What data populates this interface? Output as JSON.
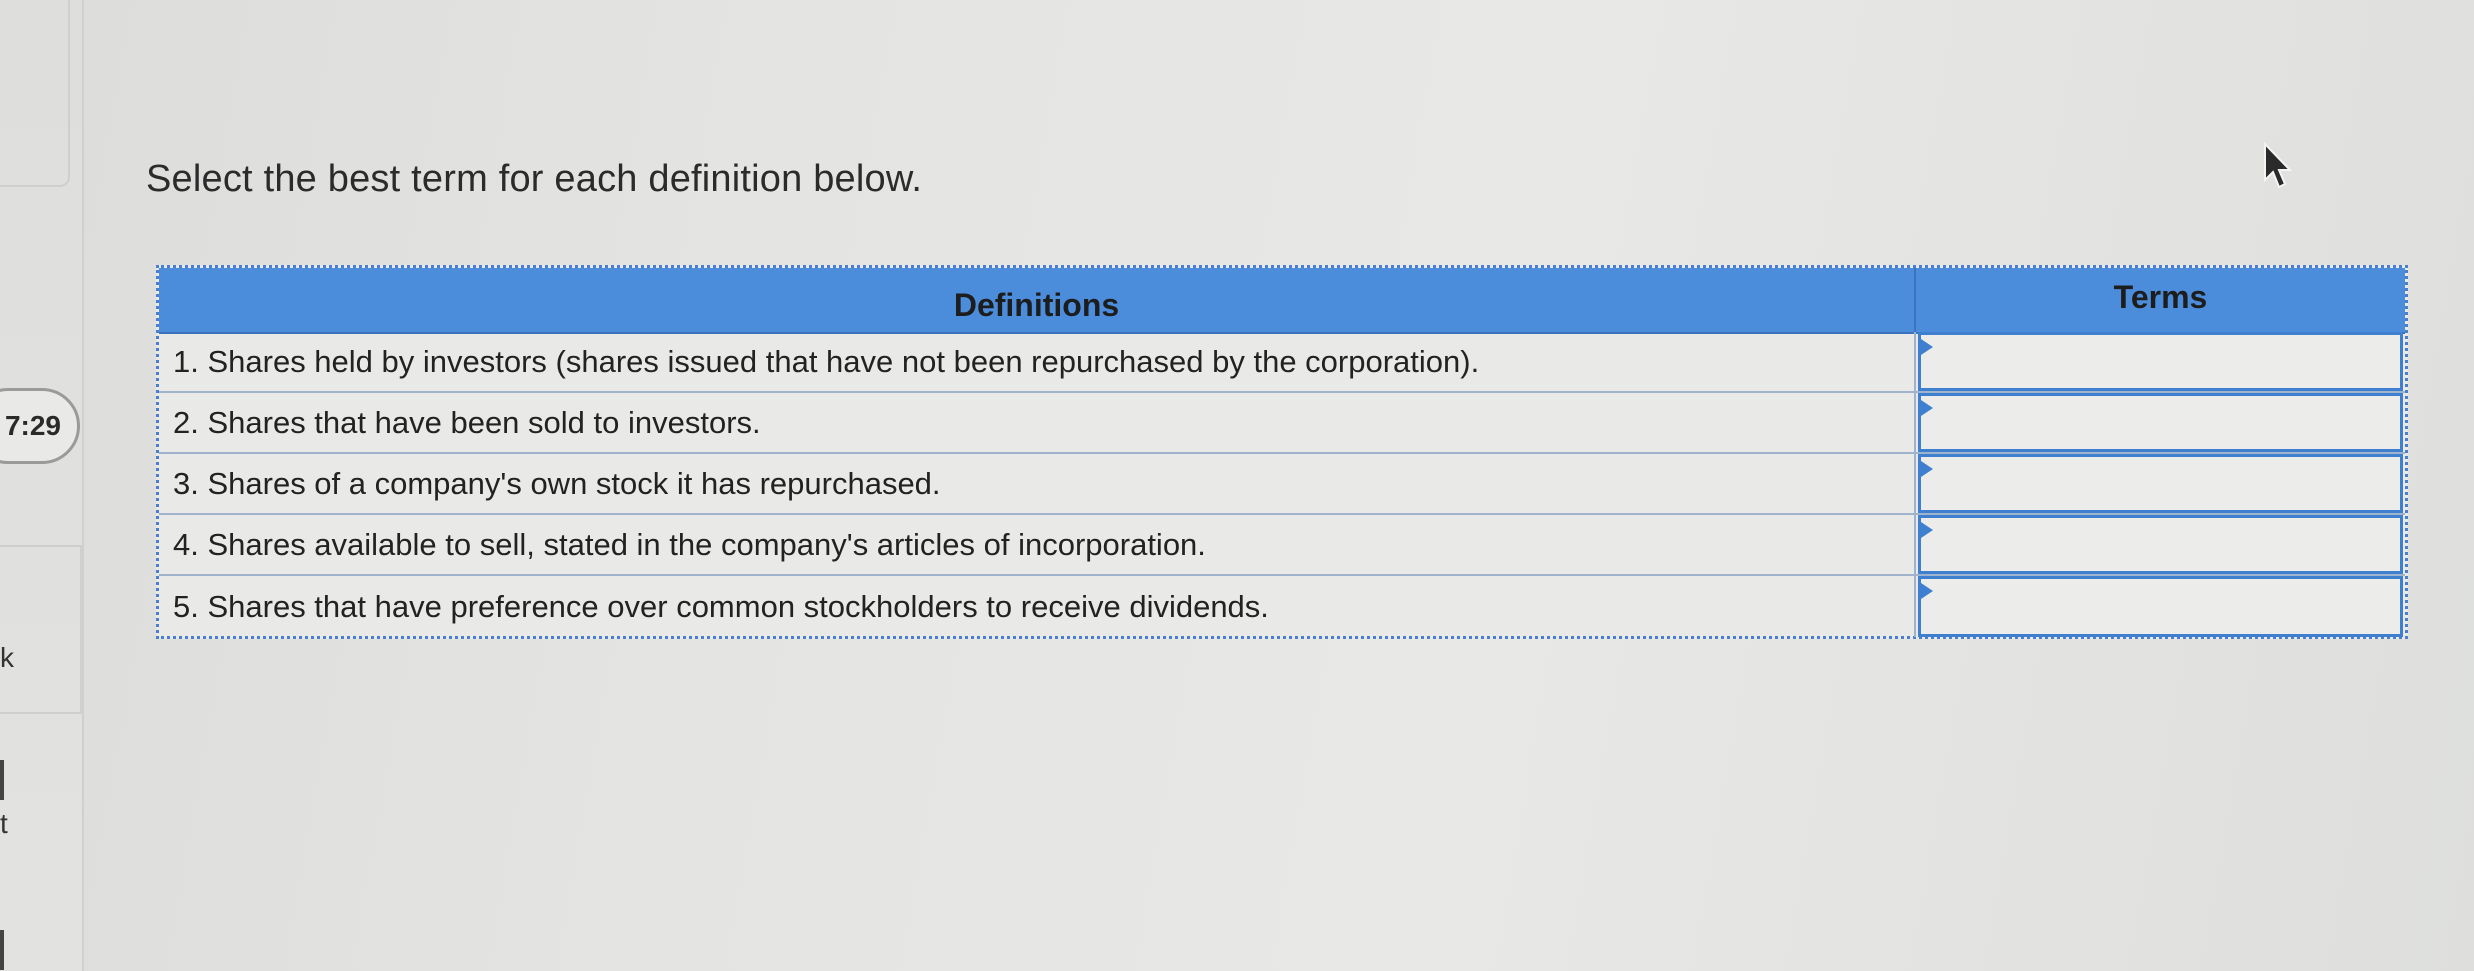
{
  "timer": "7:29",
  "sidebar": {
    "char_k": "k",
    "char_t": "t"
  },
  "instruction": "Select the best term for each definition below.",
  "table": {
    "headers": {
      "definitions": "Definitions",
      "terms": "Terms"
    },
    "rows": [
      {
        "definition": "1. Shares held by investors (shares issued that have not been repurchased by the corporation).",
        "term": ""
      },
      {
        "definition": "2. Shares that have been sold to investors.",
        "term": ""
      },
      {
        "definition": "3. Shares of a company's own stock it has repurchased.",
        "term": ""
      },
      {
        "definition": "4. Shares available to sell, stated in the company's articles of incorporation.",
        "term": ""
      },
      {
        "definition": "5. Shares that have preference over common stockholders to receive dividends.",
        "term": ""
      }
    ]
  },
  "colors": {
    "header_blue": "#4b8ddb",
    "term_border_blue": "#3f7fd0"
  },
  "icons": {
    "cursor": "mouse-pointer-icon"
  }
}
